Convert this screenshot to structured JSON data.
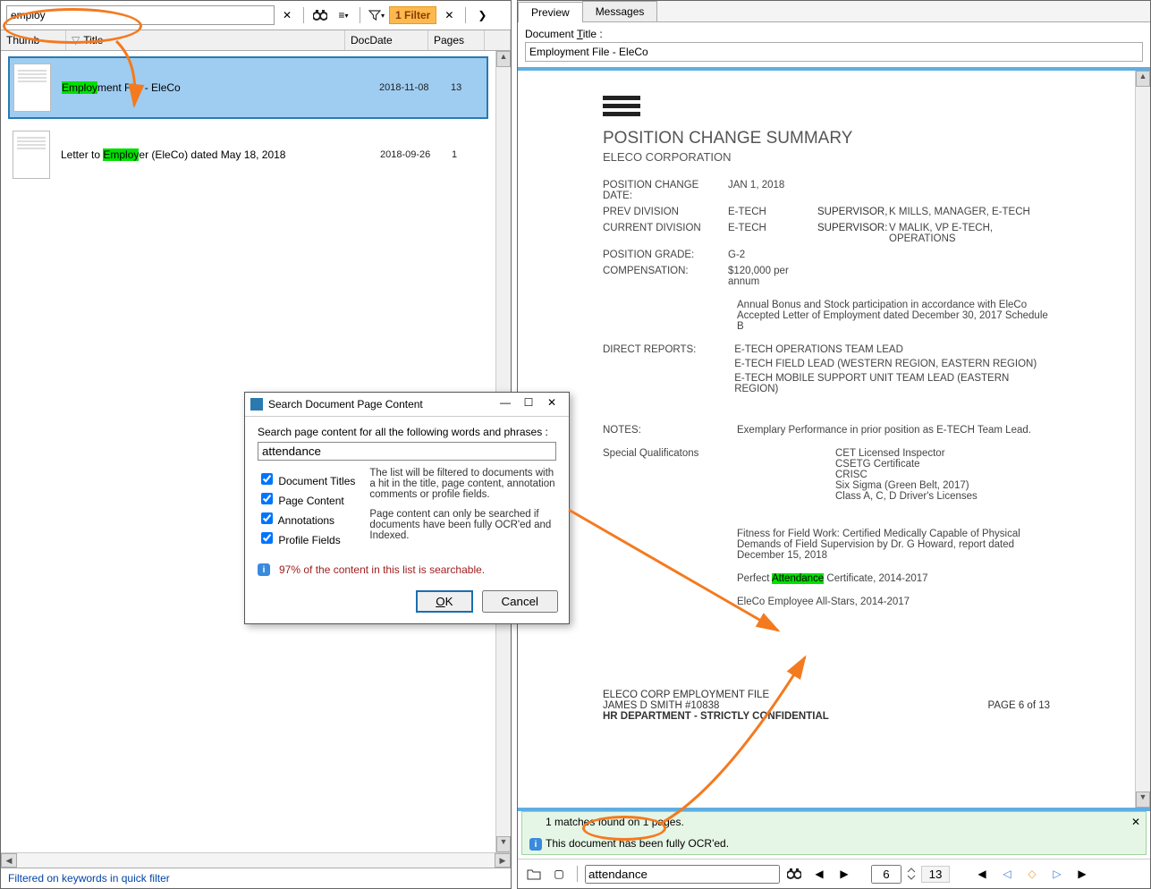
{
  "left": {
    "search_value": "employ",
    "filter_badge": "1 Filter",
    "headers": {
      "thumb": "Thumb",
      "title": "Title",
      "date": "DocDate",
      "pages": "Pages"
    },
    "rows": [
      {
        "title_pre": "",
        "hl": "Employ",
        "title_post": "ment File - EleCo",
        "date": "2018-11-08",
        "pages": "13",
        "selected": true
      },
      {
        "title_pre": "Letter to ",
        "hl": "Employ",
        "title_post": "er (EleCo) dated May 18, 2018",
        "date": "2018-09-26",
        "pages": "1",
        "selected": false
      }
    ],
    "status": "Filtered on keywords in quick filter"
  },
  "dialog": {
    "title": "Search Document Page Content",
    "prompt": "Search page content for all the following words and phrases :",
    "value": "attendance",
    "checks": [
      "Document Titles",
      "Page Content",
      "Annotations",
      "Profile Fields"
    ],
    "help1": "The list will be filtered to documents with a hit in the title, page content, annotation comments or profile fields.",
    "help2": "Page content can only be searched if documents have been fully OCR'ed and Indexed.",
    "status": "97% of the content in this list is searchable.",
    "ok": "OK",
    "cancel": "Cancel"
  },
  "right": {
    "tabs": [
      "Preview",
      "Messages"
    ],
    "doc_title_label": "Document Title :",
    "doc_title_label_u": "T",
    "doc_title_value": "Employment File - EleCo",
    "doc": {
      "h1": "POSITION CHANGE SUMMARY",
      "h2": "ELECO CORPORATION",
      "fields": [
        {
          "lab": "POSITION CHANGE DATE:",
          "val": "JAN 1, 2018"
        },
        {
          "lab": "PREV DIVISION",
          "val": "E-TECH",
          "sup": "SUPERVISOR,",
          "val2": "K MILLS, MANAGER, E-TECH"
        },
        {
          "lab": "CURRENT DIVISION",
          "val": "E-TECH",
          "sup": "SUPERVISOR:",
          "val2": "V MALIK,  VP E-TECH, OPERATIONS"
        },
        {
          "lab": "POSITION GRADE:",
          "val": "G-2"
        },
        {
          "lab": "COMPENSATION:",
          "val": "$120,000 per annum"
        }
      ],
      "comp_note": "Annual Bonus and Stock participation in accordance with EleCo Accepted Letter of Employment dated December 30, 2017 Schedule B",
      "reports_lab": "DIRECT REPORTS:",
      "reports": [
        "E-TECH OPERATIONS TEAM LEAD",
        "E-TECH FIELD LEAD (WESTERN REGION, EASTERN REGION)",
        "E-TECH MOBILE SUPPORT UNIT TEAM LEAD (EASTERN REGION)"
      ],
      "notes_lab": "NOTES:",
      "notes": "Exemplary Performance in prior position as E-TECH Team Lead.",
      "qual_lab": "Special Qualificatons",
      "quals": [
        "CET Licensed Inspector",
        "CSETG Certificate",
        "CRISC",
        "Six Sigma (Green Belt, 2017)",
        "Class A, C, D Driver's Licenses"
      ],
      "fitness": "Fitness for Field Work: Certified Medically Capable of Physical Demands of Field Supervision by Dr. G Howard, report dated December 15, 2018",
      "attend_pre": "Perfect ",
      "attend_hl": "Attendance",
      "attend_post": " Certificate, 2014-2017",
      "allstars": "EleCo Employee All-Stars, 2014-2017",
      "footer1": "ELECO CORP EMPLOYMENT FILE",
      "footer2": "JAMES D SMITH #10838",
      "footer3": "HR DEPARTMENT - STRICTLY CONFIDENTIAL",
      "page": "PAGE 6 of 13"
    },
    "match_text": "1 matches found on 1 pages.",
    "ocr_text": "This document has been fully OCR'ed.",
    "bottom_search": "attendance",
    "page_current": "6",
    "page_total": "13"
  }
}
